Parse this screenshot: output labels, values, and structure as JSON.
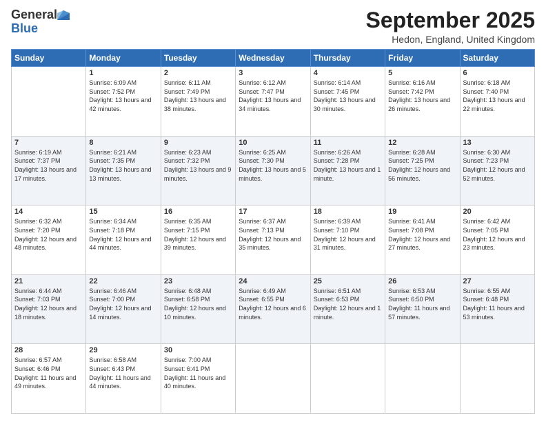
{
  "header": {
    "logo_general": "General",
    "logo_blue": "Blue",
    "title": "September 2025",
    "location": "Hedon, England, United Kingdom"
  },
  "days_of_week": [
    "Sunday",
    "Monday",
    "Tuesday",
    "Wednesday",
    "Thursday",
    "Friday",
    "Saturday"
  ],
  "weeks": [
    [
      {
        "day": "",
        "sunrise": "",
        "sunset": "",
        "daylight": ""
      },
      {
        "day": "1",
        "sunrise": "Sunrise: 6:09 AM",
        "sunset": "Sunset: 7:52 PM",
        "daylight": "Daylight: 13 hours and 42 minutes."
      },
      {
        "day": "2",
        "sunrise": "Sunrise: 6:11 AM",
        "sunset": "Sunset: 7:49 PM",
        "daylight": "Daylight: 13 hours and 38 minutes."
      },
      {
        "day": "3",
        "sunrise": "Sunrise: 6:12 AM",
        "sunset": "Sunset: 7:47 PM",
        "daylight": "Daylight: 13 hours and 34 minutes."
      },
      {
        "day": "4",
        "sunrise": "Sunrise: 6:14 AM",
        "sunset": "Sunset: 7:45 PM",
        "daylight": "Daylight: 13 hours and 30 minutes."
      },
      {
        "day": "5",
        "sunrise": "Sunrise: 6:16 AM",
        "sunset": "Sunset: 7:42 PM",
        "daylight": "Daylight: 13 hours and 26 minutes."
      },
      {
        "day": "6",
        "sunrise": "Sunrise: 6:18 AM",
        "sunset": "Sunset: 7:40 PM",
        "daylight": "Daylight: 13 hours and 22 minutes."
      }
    ],
    [
      {
        "day": "7",
        "sunrise": "Sunrise: 6:19 AM",
        "sunset": "Sunset: 7:37 PM",
        "daylight": "Daylight: 13 hours and 17 minutes."
      },
      {
        "day": "8",
        "sunrise": "Sunrise: 6:21 AM",
        "sunset": "Sunset: 7:35 PM",
        "daylight": "Daylight: 13 hours and 13 minutes."
      },
      {
        "day": "9",
        "sunrise": "Sunrise: 6:23 AM",
        "sunset": "Sunset: 7:32 PM",
        "daylight": "Daylight: 13 hours and 9 minutes."
      },
      {
        "day": "10",
        "sunrise": "Sunrise: 6:25 AM",
        "sunset": "Sunset: 7:30 PM",
        "daylight": "Daylight: 13 hours and 5 minutes."
      },
      {
        "day": "11",
        "sunrise": "Sunrise: 6:26 AM",
        "sunset": "Sunset: 7:28 PM",
        "daylight": "Daylight: 13 hours and 1 minute."
      },
      {
        "day": "12",
        "sunrise": "Sunrise: 6:28 AM",
        "sunset": "Sunset: 7:25 PM",
        "daylight": "Daylight: 12 hours and 56 minutes."
      },
      {
        "day": "13",
        "sunrise": "Sunrise: 6:30 AM",
        "sunset": "Sunset: 7:23 PM",
        "daylight": "Daylight: 12 hours and 52 minutes."
      }
    ],
    [
      {
        "day": "14",
        "sunrise": "Sunrise: 6:32 AM",
        "sunset": "Sunset: 7:20 PM",
        "daylight": "Daylight: 12 hours and 48 minutes."
      },
      {
        "day": "15",
        "sunrise": "Sunrise: 6:34 AM",
        "sunset": "Sunset: 7:18 PM",
        "daylight": "Daylight: 12 hours and 44 minutes."
      },
      {
        "day": "16",
        "sunrise": "Sunrise: 6:35 AM",
        "sunset": "Sunset: 7:15 PM",
        "daylight": "Daylight: 12 hours and 39 minutes."
      },
      {
        "day": "17",
        "sunrise": "Sunrise: 6:37 AM",
        "sunset": "Sunset: 7:13 PM",
        "daylight": "Daylight: 12 hours and 35 minutes."
      },
      {
        "day": "18",
        "sunrise": "Sunrise: 6:39 AM",
        "sunset": "Sunset: 7:10 PM",
        "daylight": "Daylight: 12 hours and 31 minutes."
      },
      {
        "day": "19",
        "sunrise": "Sunrise: 6:41 AM",
        "sunset": "Sunset: 7:08 PM",
        "daylight": "Daylight: 12 hours and 27 minutes."
      },
      {
        "day": "20",
        "sunrise": "Sunrise: 6:42 AM",
        "sunset": "Sunset: 7:05 PM",
        "daylight": "Daylight: 12 hours and 23 minutes."
      }
    ],
    [
      {
        "day": "21",
        "sunrise": "Sunrise: 6:44 AM",
        "sunset": "Sunset: 7:03 PM",
        "daylight": "Daylight: 12 hours and 18 minutes."
      },
      {
        "day": "22",
        "sunrise": "Sunrise: 6:46 AM",
        "sunset": "Sunset: 7:00 PM",
        "daylight": "Daylight: 12 hours and 14 minutes."
      },
      {
        "day": "23",
        "sunrise": "Sunrise: 6:48 AM",
        "sunset": "Sunset: 6:58 PM",
        "daylight": "Daylight: 12 hours and 10 minutes."
      },
      {
        "day": "24",
        "sunrise": "Sunrise: 6:49 AM",
        "sunset": "Sunset: 6:55 PM",
        "daylight": "Daylight: 12 hours and 6 minutes."
      },
      {
        "day": "25",
        "sunrise": "Sunrise: 6:51 AM",
        "sunset": "Sunset: 6:53 PM",
        "daylight": "Daylight: 12 hours and 1 minute."
      },
      {
        "day": "26",
        "sunrise": "Sunrise: 6:53 AM",
        "sunset": "Sunset: 6:50 PM",
        "daylight": "Daylight: 11 hours and 57 minutes."
      },
      {
        "day": "27",
        "sunrise": "Sunrise: 6:55 AM",
        "sunset": "Sunset: 6:48 PM",
        "daylight": "Daylight: 11 hours and 53 minutes."
      }
    ],
    [
      {
        "day": "28",
        "sunrise": "Sunrise: 6:57 AM",
        "sunset": "Sunset: 6:46 PM",
        "daylight": "Daylight: 11 hours and 49 minutes."
      },
      {
        "day": "29",
        "sunrise": "Sunrise: 6:58 AM",
        "sunset": "Sunset: 6:43 PM",
        "daylight": "Daylight: 11 hours and 44 minutes."
      },
      {
        "day": "30",
        "sunrise": "Sunrise: 7:00 AM",
        "sunset": "Sunset: 6:41 PM",
        "daylight": "Daylight: 11 hours and 40 minutes."
      },
      {
        "day": "",
        "sunrise": "",
        "sunset": "",
        "daylight": ""
      },
      {
        "day": "",
        "sunrise": "",
        "sunset": "",
        "daylight": ""
      },
      {
        "day": "",
        "sunrise": "",
        "sunset": "",
        "daylight": ""
      },
      {
        "day": "",
        "sunrise": "",
        "sunset": "",
        "daylight": ""
      }
    ]
  ]
}
